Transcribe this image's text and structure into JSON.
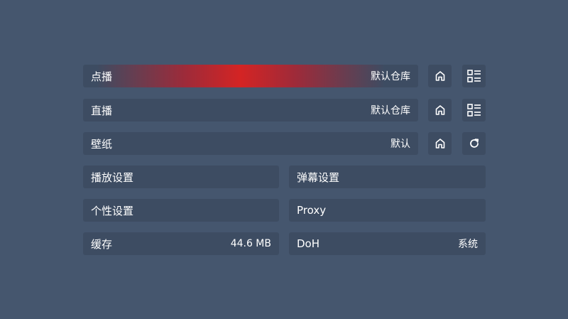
{
  "settings": {
    "vod": {
      "label": "点播",
      "value": "默认仓库"
    },
    "live": {
      "label": "直播",
      "value": "默认仓库"
    },
    "wallpaper": {
      "label": "壁纸",
      "value": "默认"
    },
    "player": {
      "label": "播放设置"
    },
    "danmaku": {
      "label": "弹幕设置"
    },
    "personal": {
      "label": "个性设置"
    },
    "proxy": {
      "label": "Proxy"
    },
    "cache": {
      "label": "缓存",
      "value": "44.6 MB"
    },
    "doh": {
      "label": "DoH",
      "value": "系统"
    }
  },
  "icons": {
    "vod_home": "home-icon",
    "vod_list": "list-icon",
    "live_home": "home-icon",
    "live_list": "list-icon",
    "wallpaper_home": "home-icon",
    "wallpaper_refresh": "refresh-icon"
  },
  "colors": {
    "background": "#45566e",
    "tile": "#3d4c62",
    "focus_accent": "#d42424"
  }
}
